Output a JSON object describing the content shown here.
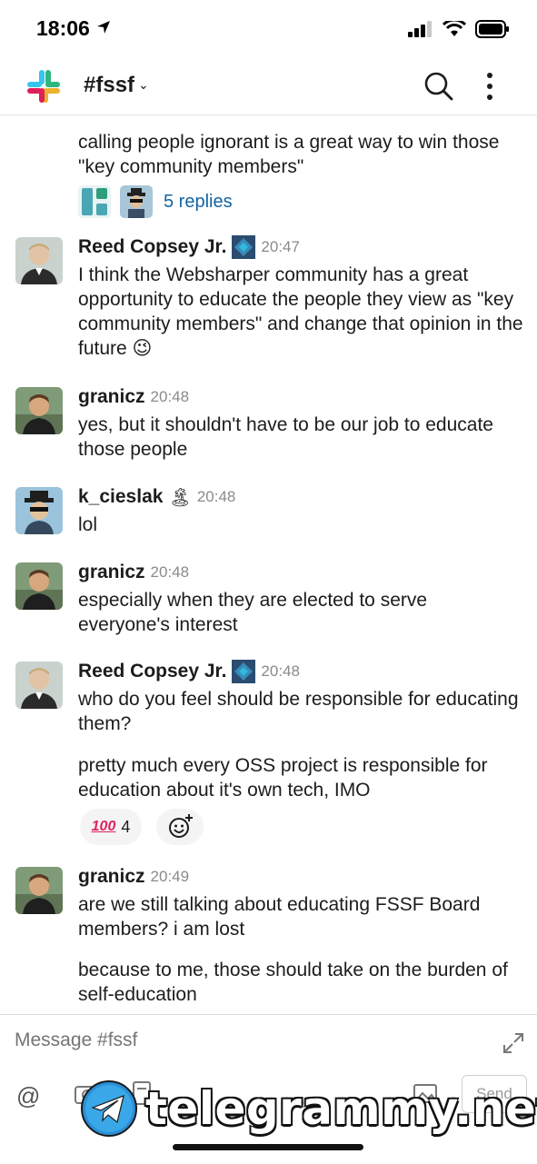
{
  "status_bar": {
    "time": "18:06"
  },
  "header": {
    "channel": "#fssf",
    "chevron": "⌄"
  },
  "thread_preview": {
    "text": "calling people ignorant is a great way to win those \"key community members\"",
    "replies_label": "5 replies"
  },
  "messages": [
    {
      "author": "Reed Copsey Jr.",
      "time": "20:47",
      "text": "I think the Websharper community has a great opportunity to educate the people they view as \"key community members\" and change that opinion in the future 😉"
    },
    {
      "author": "granicz",
      "time": "20:48",
      "text": "yes, but it shouldn't have to be our job to educate those people"
    },
    {
      "author": "k_cieslak",
      "status_emoji": "🏝",
      "time": "20:48",
      "text": "lol"
    },
    {
      "author": "granicz",
      "time": "20:48",
      "text": "especially when they are elected to serve everyone's interest"
    },
    {
      "author": "Reed Copsey Jr.",
      "time": "20:48",
      "text": "who do you feel should be responsible for educating them?",
      "text2": "pretty much every OSS project is responsible for education about it's own tech, IMO",
      "reaction": {
        "emoji": "100",
        "count": "4"
      }
    },
    {
      "author": "granicz",
      "time": "20:49",
      "text": "are we still talking about educating FSSF Board members? i am lost",
      "text2": "because to me, those should take on the burden of self-education"
    }
  ],
  "composer": {
    "placeholder": "Message #fssf",
    "at": "@",
    "send": "Send"
  },
  "watermark": {
    "text": "telegrammy.net"
  },
  "icons": [
    "navigation-arrow-icon",
    "signal-icon",
    "wifi-icon",
    "battery-icon",
    "slack-logo",
    "search-icon",
    "more-icon",
    "expand-icon",
    "at-icon",
    "add-reaction-icon",
    "telegram-icon"
  ],
  "colors": {
    "link": "#1264a3",
    "time": "#8a8a8a",
    "text": "#1d1c1d"
  }
}
